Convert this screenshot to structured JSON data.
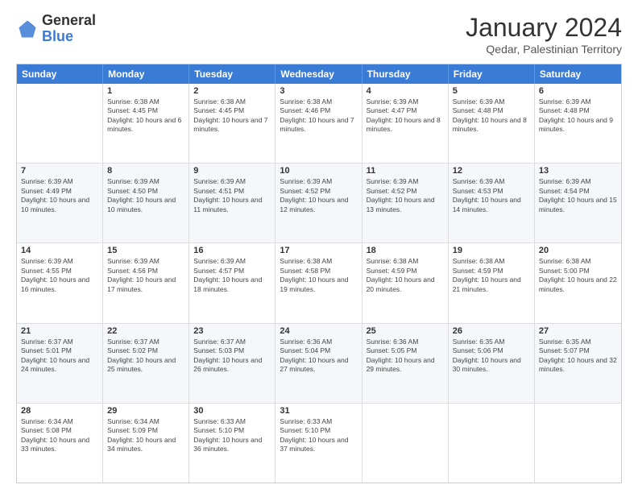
{
  "header": {
    "logo_general": "General",
    "logo_blue": "Blue",
    "title": "January 2024",
    "location": "Qedar, Palestinian Territory"
  },
  "weekdays": [
    "Sunday",
    "Monday",
    "Tuesday",
    "Wednesday",
    "Thursday",
    "Friday",
    "Saturday"
  ],
  "weeks": [
    [
      {
        "day": "",
        "sunrise": "",
        "sunset": "",
        "daylight": ""
      },
      {
        "day": "1",
        "sunrise": "Sunrise: 6:38 AM",
        "sunset": "Sunset: 4:45 PM",
        "daylight": "Daylight: 10 hours and 6 minutes."
      },
      {
        "day": "2",
        "sunrise": "Sunrise: 6:38 AM",
        "sunset": "Sunset: 4:45 PM",
        "daylight": "Daylight: 10 hours and 7 minutes."
      },
      {
        "day": "3",
        "sunrise": "Sunrise: 6:38 AM",
        "sunset": "Sunset: 4:46 PM",
        "daylight": "Daylight: 10 hours and 7 minutes."
      },
      {
        "day": "4",
        "sunrise": "Sunrise: 6:39 AM",
        "sunset": "Sunset: 4:47 PM",
        "daylight": "Daylight: 10 hours and 8 minutes."
      },
      {
        "day": "5",
        "sunrise": "Sunrise: 6:39 AM",
        "sunset": "Sunset: 4:48 PM",
        "daylight": "Daylight: 10 hours and 8 minutes."
      },
      {
        "day": "6",
        "sunrise": "Sunrise: 6:39 AM",
        "sunset": "Sunset: 4:48 PM",
        "daylight": "Daylight: 10 hours and 9 minutes."
      }
    ],
    [
      {
        "day": "7",
        "sunrise": "Sunrise: 6:39 AM",
        "sunset": "Sunset: 4:49 PM",
        "daylight": "Daylight: 10 hours and 10 minutes."
      },
      {
        "day": "8",
        "sunrise": "Sunrise: 6:39 AM",
        "sunset": "Sunset: 4:50 PM",
        "daylight": "Daylight: 10 hours and 10 minutes."
      },
      {
        "day": "9",
        "sunrise": "Sunrise: 6:39 AM",
        "sunset": "Sunset: 4:51 PM",
        "daylight": "Daylight: 10 hours and 11 minutes."
      },
      {
        "day": "10",
        "sunrise": "Sunrise: 6:39 AM",
        "sunset": "Sunset: 4:52 PM",
        "daylight": "Daylight: 10 hours and 12 minutes."
      },
      {
        "day": "11",
        "sunrise": "Sunrise: 6:39 AM",
        "sunset": "Sunset: 4:52 PM",
        "daylight": "Daylight: 10 hours and 13 minutes."
      },
      {
        "day": "12",
        "sunrise": "Sunrise: 6:39 AM",
        "sunset": "Sunset: 4:53 PM",
        "daylight": "Daylight: 10 hours and 14 minutes."
      },
      {
        "day": "13",
        "sunrise": "Sunrise: 6:39 AM",
        "sunset": "Sunset: 4:54 PM",
        "daylight": "Daylight: 10 hours and 15 minutes."
      }
    ],
    [
      {
        "day": "14",
        "sunrise": "Sunrise: 6:39 AM",
        "sunset": "Sunset: 4:55 PM",
        "daylight": "Daylight: 10 hours and 16 minutes."
      },
      {
        "day": "15",
        "sunrise": "Sunrise: 6:39 AM",
        "sunset": "Sunset: 4:56 PM",
        "daylight": "Daylight: 10 hours and 17 minutes."
      },
      {
        "day": "16",
        "sunrise": "Sunrise: 6:39 AM",
        "sunset": "Sunset: 4:57 PM",
        "daylight": "Daylight: 10 hours and 18 minutes."
      },
      {
        "day": "17",
        "sunrise": "Sunrise: 6:38 AM",
        "sunset": "Sunset: 4:58 PM",
        "daylight": "Daylight: 10 hours and 19 minutes."
      },
      {
        "day": "18",
        "sunrise": "Sunrise: 6:38 AM",
        "sunset": "Sunset: 4:59 PM",
        "daylight": "Daylight: 10 hours and 20 minutes."
      },
      {
        "day": "19",
        "sunrise": "Sunrise: 6:38 AM",
        "sunset": "Sunset: 4:59 PM",
        "daylight": "Daylight: 10 hours and 21 minutes."
      },
      {
        "day": "20",
        "sunrise": "Sunrise: 6:38 AM",
        "sunset": "Sunset: 5:00 PM",
        "daylight": "Daylight: 10 hours and 22 minutes."
      }
    ],
    [
      {
        "day": "21",
        "sunrise": "Sunrise: 6:37 AM",
        "sunset": "Sunset: 5:01 PM",
        "daylight": "Daylight: 10 hours and 24 minutes."
      },
      {
        "day": "22",
        "sunrise": "Sunrise: 6:37 AM",
        "sunset": "Sunset: 5:02 PM",
        "daylight": "Daylight: 10 hours and 25 minutes."
      },
      {
        "day": "23",
        "sunrise": "Sunrise: 6:37 AM",
        "sunset": "Sunset: 5:03 PM",
        "daylight": "Daylight: 10 hours and 26 minutes."
      },
      {
        "day": "24",
        "sunrise": "Sunrise: 6:36 AM",
        "sunset": "Sunset: 5:04 PM",
        "daylight": "Daylight: 10 hours and 27 minutes."
      },
      {
        "day": "25",
        "sunrise": "Sunrise: 6:36 AM",
        "sunset": "Sunset: 5:05 PM",
        "daylight": "Daylight: 10 hours and 29 minutes."
      },
      {
        "day": "26",
        "sunrise": "Sunrise: 6:35 AM",
        "sunset": "Sunset: 5:06 PM",
        "daylight": "Daylight: 10 hours and 30 minutes."
      },
      {
        "day": "27",
        "sunrise": "Sunrise: 6:35 AM",
        "sunset": "Sunset: 5:07 PM",
        "daylight": "Daylight: 10 hours and 32 minutes."
      }
    ],
    [
      {
        "day": "28",
        "sunrise": "Sunrise: 6:34 AM",
        "sunset": "Sunset: 5:08 PM",
        "daylight": "Daylight: 10 hours and 33 minutes."
      },
      {
        "day": "29",
        "sunrise": "Sunrise: 6:34 AM",
        "sunset": "Sunset: 5:09 PM",
        "daylight": "Daylight: 10 hours and 34 minutes."
      },
      {
        "day": "30",
        "sunrise": "Sunrise: 6:33 AM",
        "sunset": "Sunset: 5:10 PM",
        "daylight": "Daylight: 10 hours and 36 minutes."
      },
      {
        "day": "31",
        "sunrise": "Sunrise: 6:33 AM",
        "sunset": "Sunset: 5:10 PM",
        "daylight": "Daylight: 10 hours and 37 minutes."
      },
      {
        "day": "",
        "sunrise": "",
        "sunset": "",
        "daylight": ""
      },
      {
        "day": "",
        "sunrise": "",
        "sunset": "",
        "daylight": ""
      },
      {
        "day": "",
        "sunrise": "",
        "sunset": "",
        "daylight": ""
      }
    ]
  ]
}
